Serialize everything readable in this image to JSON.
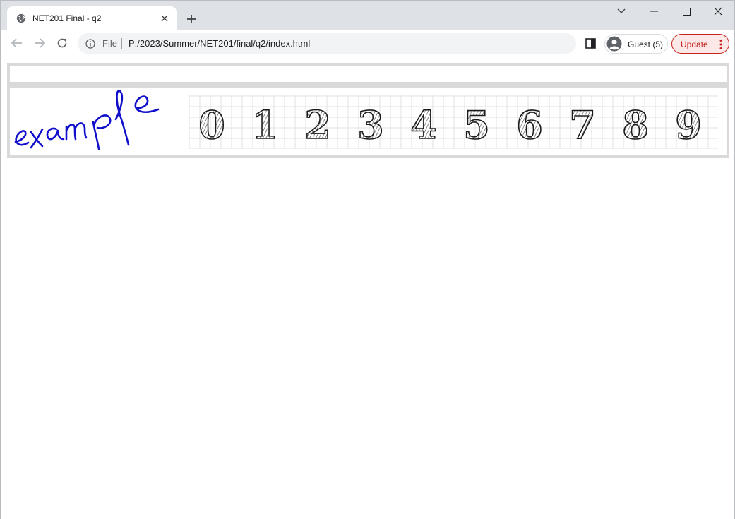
{
  "browser": {
    "tab_title": "NET201 Final - q2",
    "icons": {
      "favicon": "globe-icon",
      "close": "close-icon",
      "new_tab": "plus-icon",
      "tab_search": "chevron-down-icon",
      "minimize": "minimize-icon",
      "maximize": "maximize-icon",
      "window_close": "close-icon"
    },
    "toolbar": {
      "scheme_label": "File",
      "url": "P:/2023/Summer/NET201/final/q2/index.html",
      "profile_label": "Guest (5)",
      "update_label": "Update",
      "icons": [
        "back-arrow-icon",
        "forward-arrow-icon",
        "reload-icon",
        "info-icon",
        "side-panel-icon",
        "avatar-icon",
        "more-vert-icon"
      ]
    }
  },
  "page": {
    "handwriting": "example",
    "handwriting_color": "#1010cc",
    "digits": [
      "0",
      "1",
      "2",
      "3",
      "4",
      "5",
      "6",
      "7",
      "8",
      "9"
    ],
    "border_color": "#d9d9d9"
  }
}
